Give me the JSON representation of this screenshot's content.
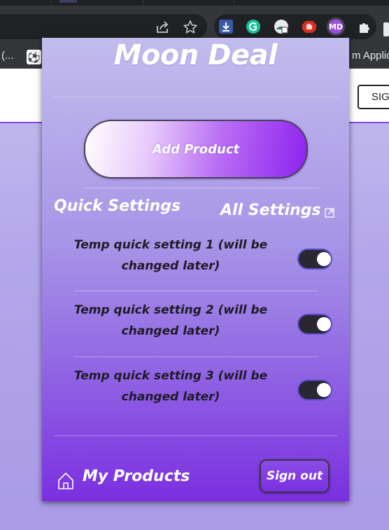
{
  "browser": {
    "bookmarks_left_text": "(...",
    "bookmarks_right_text": "m Applic",
    "page_button_label": "SIGN IN"
  },
  "toolbar_icons": [
    "share-icon",
    "star-icon"
  ],
  "extensions": [
    "download-icon",
    "grammarly-icon",
    "vpn-icon",
    "stop-hand-icon",
    "moon-deal-icon",
    "puzzle-icon"
  ],
  "popup": {
    "title": "Moon Deal",
    "add_product_label": "Add Product",
    "quick_settings_heading": "Quick Settings",
    "all_settings_label": "All Settings",
    "settings": [
      {
        "label": "Temp quick setting 1 (will be changed later)",
        "enabled": true
      },
      {
        "label": "Temp quick setting 2 (will be changed later)",
        "enabled": true
      },
      {
        "label": "Temp quick setting 3 (will be changed later)",
        "enabled": true
      }
    ],
    "my_products_label": "My Products",
    "sign_out_label": "Sign out"
  },
  "colors": {
    "accent_purple": "#7b2fe0",
    "toggle_border": "#5b4fd1",
    "toggle_track": "#2a2733"
  }
}
